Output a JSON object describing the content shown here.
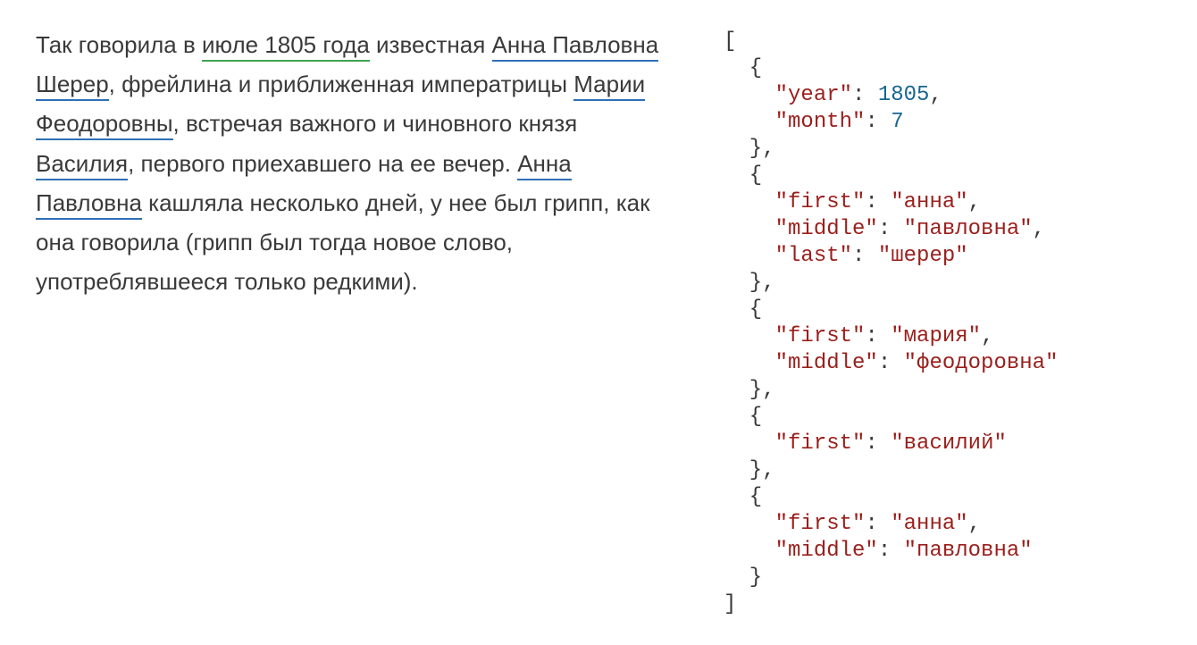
{
  "text": {
    "pre1": "Так говорила в ",
    "date": "июле 1805 года",
    "post1": " известная ",
    "name1": "Анна Павловна Шерер",
    "post2": ", фрейлина и приближенная императрицы ",
    "name2": "Марии Феодоровны",
    "post3": ", встречая важного и чиновного князя ",
    "name3": "Василия",
    "post4": ", первого приехавшего на ее вечер. ",
    "name4": "Анна Павловна",
    "post5": " кашляла несколько дней, у нее был грипп, как она говорила (грипп был тогда новое слово, употреблявшееся только редкими)."
  },
  "json": {
    "open_bracket": "[",
    "close_bracket": "]",
    "items": [
      {
        "open": "  {",
        "lines": [
          {
            "key": "    \"year\"",
            "colon": ": ",
            "val": "1805",
            "kind": "num",
            "comma": ","
          },
          {
            "key": "    \"month\"",
            "colon": ": ",
            "val": "7",
            "kind": "num",
            "comma": ""
          }
        ],
        "close": "  },"
      },
      {
        "open": "  {",
        "lines": [
          {
            "key": "    \"first\"",
            "colon": ": ",
            "val": "\"анна\"",
            "kind": "str",
            "comma": ","
          },
          {
            "key": "    \"middle\"",
            "colon": ": ",
            "val": "\"павловна\"",
            "kind": "str",
            "comma": ","
          },
          {
            "key": "    \"last\"",
            "colon": ": ",
            "val": "\"шерер\"",
            "kind": "str",
            "comma": ""
          }
        ],
        "close": "  },"
      },
      {
        "open": "  {",
        "lines": [
          {
            "key": "    \"first\"",
            "colon": ": ",
            "val": "\"мария\"",
            "kind": "str",
            "comma": ","
          },
          {
            "key": "    \"middle\"",
            "colon": ": ",
            "val": "\"феодоровна\"",
            "kind": "str",
            "comma": ""
          }
        ],
        "close": "  },"
      },
      {
        "open": "  {",
        "lines": [
          {
            "key": "    \"first\"",
            "colon": ": ",
            "val": "\"василий\"",
            "kind": "str",
            "comma": ""
          }
        ],
        "close": "  },"
      },
      {
        "open": "  {",
        "lines": [
          {
            "key": "    \"first\"",
            "colon": ": ",
            "val": "\"анна\"",
            "kind": "str",
            "comma": ","
          },
          {
            "key": "    \"middle\"",
            "colon": ": ",
            "val": "\"павловна\"",
            "kind": "str",
            "comma": ""
          }
        ],
        "close": "  }"
      }
    ]
  }
}
